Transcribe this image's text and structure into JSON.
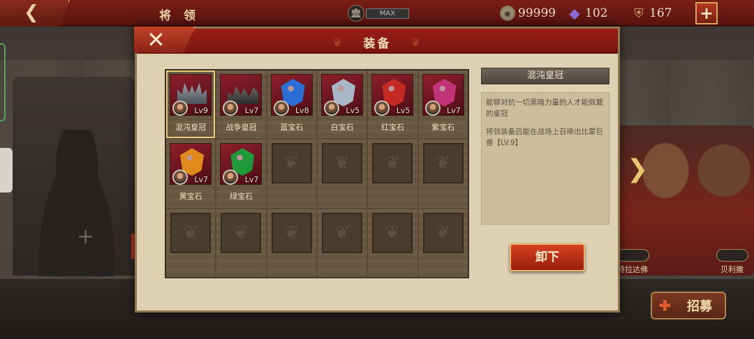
{
  "top_bar": {
    "title": "将 领",
    "max_label": "MAX",
    "coins": "99999",
    "gems": "102",
    "helmets": "167"
  },
  "dialog": {
    "title": "装备",
    "items": [
      {
        "name": "混沌皇冠",
        "level": "Lv9",
        "type": "crown",
        "selected": true
      },
      {
        "name": "战争皇冠",
        "level": "Lv7",
        "type": "war-crown"
      },
      {
        "name": "蓝宝石",
        "level": "Lv8",
        "type": "gem",
        "color": "#2a6fd6"
      },
      {
        "name": "白宝石",
        "level": "Lv5",
        "type": "gem",
        "color": "#a8b7c6"
      },
      {
        "name": "红宝石",
        "level": "Lv5",
        "type": "gem",
        "color": "#c42a22"
      },
      {
        "name": "紫宝石",
        "level": "Lv7",
        "type": "gem",
        "color": "#c2337a"
      },
      {
        "name": "黄宝石",
        "level": "Lv7",
        "type": "gem",
        "color": "#e08a1c"
      },
      {
        "name": "绿宝石",
        "level": "Lv7",
        "type": "gem",
        "color": "#1f9a3a"
      }
    ],
    "detail": {
      "title": "混沌皇冠",
      "desc1": "能够对抗一切黑暗力量的人才能佩戴的皇冠",
      "desc2": "将领装备后能在战场上召唤出比蒙巨兽【LV.9】"
    },
    "unequip_label": "卸下"
  },
  "background": {
    "hero_names": [
      "特拉达佛",
      "贝利撒"
    ],
    "recruit_label": "招募"
  }
}
